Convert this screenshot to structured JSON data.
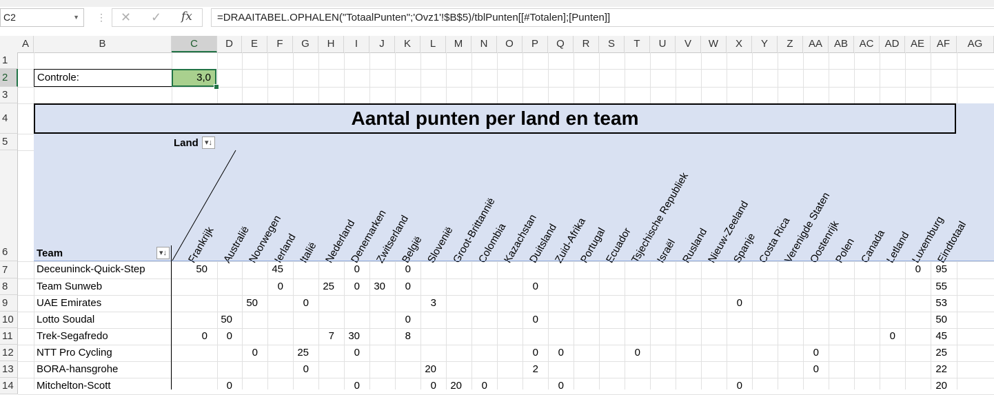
{
  "formula_bar": {
    "name_box": "C2",
    "formula": "=DRAAITABEL.OPHALEN(\"TotaalPunten\";'Ovz1'!$B$5)/tblPunten[[#Totalen];[Punten]]",
    "fx_label": "fx"
  },
  "columns": [
    "A",
    "B",
    "C",
    "D",
    "E",
    "F",
    "G",
    "H",
    "I",
    "J",
    "K",
    "L",
    "M",
    "N",
    "O",
    "P",
    "Q",
    "R",
    "S",
    "T",
    "U",
    "V",
    "W",
    "X",
    "Y",
    "Z",
    "AA",
    "AB",
    "AC",
    "AD",
    "AE",
    "AF",
    "AG"
  ],
  "rows": [
    "1",
    "2",
    "3",
    "4",
    "5",
    "6",
    "7",
    "8",
    "9",
    "10",
    "11",
    "12",
    "13",
    "14"
  ],
  "control": {
    "label": "Controle:",
    "value": "3,0"
  },
  "pivot": {
    "title": "Aantal punten per land en team",
    "row_field": "Team",
    "column_field": "Land",
    "countries": [
      "Frankrijk",
      "Australië",
      "Noorwegen",
      "Ierland",
      "Italië",
      "Nederland",
      "Denemarken",
      "Zwitserland",
      "België",
      "Slovenië",
      "Groot-Brittannië",
      "Colombia",
      "Kazachstan",
      "Duitsland",
      "Zuid-Afrika",
      "Portugal",
      "Ecuador",
      "Tsjechische Republiek",
      "Israël",
      "Rusland",
      "Nieuw-Zeeland",
      "Spanje",
      "Costa Rica",
      "Verenigde Staten",
      "Oostenrijk",
      "Polen",
      "Canada",
      "Letland",
      "Luxemburg",
      "Eindtotaal"
    ],
    "teams": [
      {
        "name": "Deceuninck-Quick-Step",
        "values": [
          "50",
          "",
          "",
          "45",
          "",
          "",
          "0",
          "",
          "0",
          "",
          "",
          "",
          "",
          "",
          "",
          "",
          "",
          "",
          "",
          "",
          "",
          "",
          "",
          "",
          "",
          "",
          "",
          "",
          "0",
          "95"
        ]
      },
      {
        "name": "Team Sunweb",
        "values": [
          "",
          "",
          "",
          "0",
          "",
          "25",
          "0",
          "30",
          "0",
          "",
          "",
          "",
          "",
          "0",
          "",
          "",
          "",
          "",
          "",
          "",
          "",
          "",
          "",
          "",
          "",
          "",
          "",
          "",
          "",
          "55"
        ]
      },
      {
        "name": "UAE Emirates",
        "values": [
          "",
          "",
          "50",
          "",
          "0",
          "",
          "",
          "",
          "",
          "3",
          "",
          "",
          "",
          "",
          "",
          "",
          "",
          "",
          "",
          "",
          "",
          "0",
          "",
          "",
          "",
          "",
          "",
          "",
          "",
          "53"
        ]
      },
      {
        "name": "Lotto Soudal",
        "values": [
          "",
          "50",
          "",
          "",
          "",
          "",
          "",
          "",
          "0",
          "",
          "",
          "",
          "",
          "0",
          "",
          "",
          "",
          "",
          "",
          "",
          "",
          "",
          "",
          "",
          "",
          "",
          "",
          "",
          "",
          "50"
        ]
      },
      {
        "name": "Trek-Segafredo",
        "values": [
          "0",
          "0",
          "",
          "",
          "",
          "7",
          "30",
          "",
          "8",
          "",
          "",
          "",
          "",
          "",
          "",
          "",
          "",
          "",
          "",
          "",
          "",
          "",
          "",
          "",
          "",
          "",
          "",
          "0",
          "",
          "45"
        ]
      },
      {
        "name": "NTT Pro Cycling",
        "values": [
          "",
          "",
          "0",
          "",
          "25",
          "",
          "0",
          "",
          "",
          "",
          "",
          "",
          "",
          "0",
          "0",
          "",
          "",
          "0",
          "",
          "",
          "",
          "",
          "",
          "",
          "0",
          "",
          "",
          "",
          "",
          "25"
        ]
      },
      {
        "name": "BORA-hansgrohe",
        "values": [
          "",
          "",
          "",
          "",
          "0",
          "",
          "",
          "",
          "",
          "20",
          "",
          "",
          "",
          "2",
          "",
          "",
          "",
          "",
          "",
          "",
          "",
          "",
          "",
          "",
          "0",
          "",
          "",
          "",
          "",
          "22"
        ]
      },
      {
        "name": "Mitchelton-Scott",
        "values": [
          "",
          "0",
          "",
          "",
          "",
          "",
          "0",
          "",
          "",
          "0",
          "20",
          "0",
          "",
          "",
          "0",
          "",
          "",
          "",
          "",
          "",
          "",
          "0",
          "",
          "",
          "",
          "",
          "",
          "",
          "",
          "20"
        ]
      }
    ]
  }
}
